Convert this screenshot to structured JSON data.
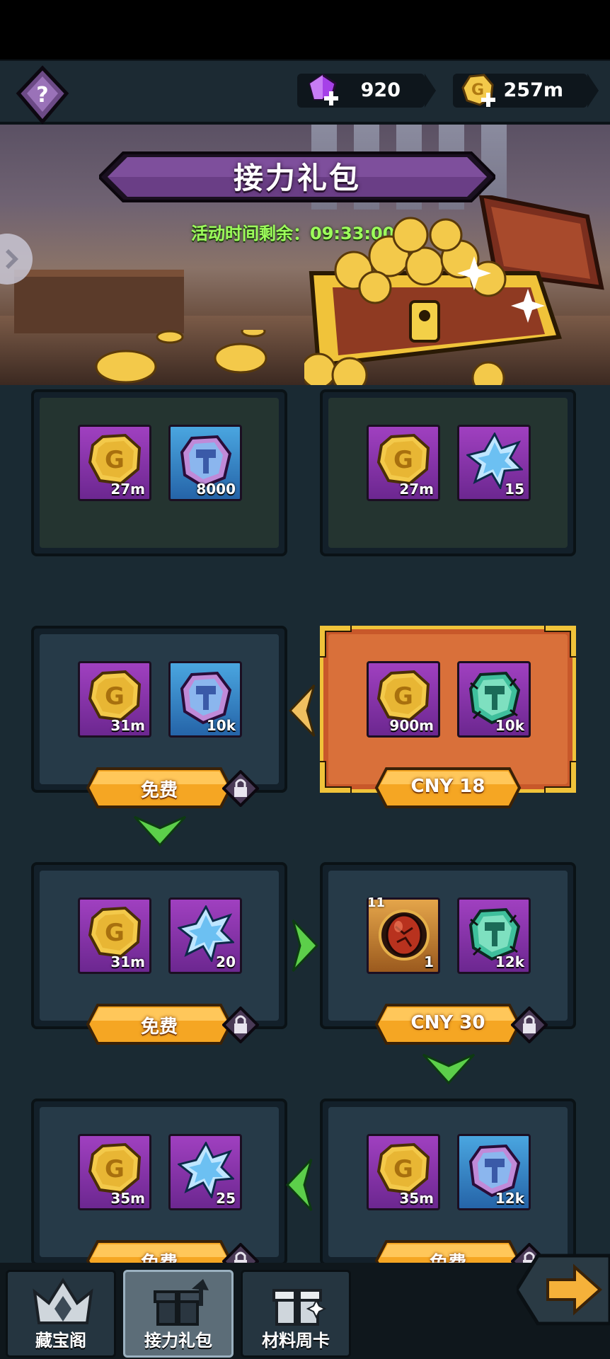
{
  "topbar": {
    "gems": "920",
    "gold": "257m"
  },
  "banner": {
    "title": "接力礼包",
    "timer_label": "活动时间剩余：",
    "timer_value": "09:33:00"
  },
  "cards": [
    {
      "items": [
        {
          "type": "gold-coin",
          "qty": "27m"
        },
        {
          "type": "hammer-stone",
          "qty": "8000"
        }
      ]
    },
    {
      "items": [
        {
          "type": "gold-coin",
          "qty": "27m"
        },
        {
          "type": "crystal",
          "qty": "15"
        }
      ]
    },
    {
      "items": [
        {
          "type": "gold-coin",
          "qty": "31m"
        },
        {
          "type": "hammer-stone",
          "qty": "10k"
        }
      ],
      "button": "免费"
    },
    {
      "items": [
        {
          "type": "gold-coin",
          "qty": "900m"
        },
        {
          "type": "thorn-stone",
          "qty": "10k"
        }
      ],
      "button": "CNY 18"
    },
    {
      "items": [
        {
          "type": "gold-coin",
          "qty": "31m"
        },
        {
          "type": "crystal",
          "qty": "20"
        }
      ],
      "button": "免费"
    },
    {
      "items": [
        {
          "type": "dragon-egg",
          "qty": "1",
          "level": "11"
        },
        {
          "type": "thorn-stone",
          "qty": "12k"
        }
      ],
      "button": "CNY 30"
    },
    {
      "items": [
        {
          "type": "gold-coin",
          "qty": "35m"
        },
        {
          "type": "crystal",
          "qty": "25"
        }
      ],
      "button": "免费"
    },
    {
      "items": [
        {
          "type": "gold-coin",
          "qty": "35m"
        },
        {
          "type": "hammer-stone",
          "qty": "12k"
        }
      ],
      "button": "免费"
    }
  ],
  "bottomnav": {
    "tab1": "藏宝阁",
    "tab2": "接力礼包",
    "tab3": "材料周卡"
  },
  "colors": {
    "accent_orange": "#f5a623",
    "panel_dark": "#1a2a33",
    "timer_green": "#9dff5b"
  }
}
